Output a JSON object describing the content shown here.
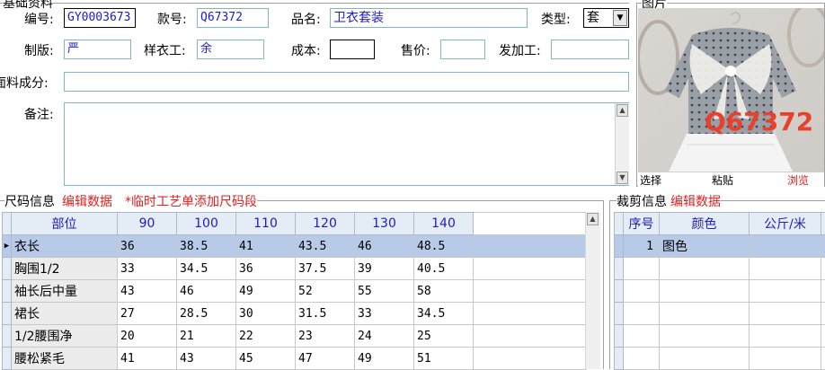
{
  "basic": {
    "title": "基础资料",
    "labels": {
      "code": "编号:",
      "style_no": "款号:",
      "product_name": "品名:",
      "type": "类型:",
      "pattern": "制版:",
      "sample_worker": "样衣工:",
      "cost": "成本:",
      "price": "售价:",
      "outsource": "发加工:",
      "fabric": "面料成分:",
      "remarks": "备注:"
    },
    "values": {
      "code": "GY0003673",
      "style_no": "Q67372",
      "product_name": "卫衣套装",
      "type": "套",
      "pattern": "严",
      "sample_worker": "余",
      "cost": "",
      "price": "",
      "outsource": "",
      "fabric": "",
      "remarks": ""
    }
  },
  "image_panel": {
    "title": "图片",
    "watermark": "Q67372",
    "actions": {
      "select": "选择",
      "paste": "粘贴",
      "browse": "浏览"
    }
  },
  "size_info": {
    "title": "尺码信息",
    "edit_link": "编辑数据",
    "note": "*临时工艺单添加尺码段",
    "headers": [
      "部位",
      "90",
      "100",
      "110",
      "120",
      "130",
      "140"
    ],
    "rows": [
      [
        "衣长",
        "36",
        "38.5",
        "41",
        "43.5",
        "46",
        "48.5"
      ],
      [
        "胸围1/2",
        "33",
        "34.5",
        "36",
        "37.5",
        "39",
        "40.5"
      ],
      [
        "袖长后中量",
        "43",
        "46",
        "49",
        "52",
        "55",
        "58"
      ],
      [
        "裙长",
        "27",
        "28.5",
        "30",
        "31.5",
        "33",
        "34.5"
      ],
      [
        "1/2腰围净",
        "20",
        "21",
        "22",
        "23",
        "24",
        "25"
      ],
      [
        "腰松紧毛",
        "41",
        "43",
        "45",
        "47",
        "49",
        "51"
      ]
    ]
  },
  "cutting_info": {
    "title": "裁剪信息",
    "edit_link": "编辑数据",
    "headers": [
      "序号",
      "颜色",
      "公斤/米"
    ],
    "rows": [
      [
        "1",
        "图色",
        ""
      ]
    ]
  },
  "colors": {
    "accent_red": "#e02020",
    "header_text": "#2020c0",
    "selected_row": "#b7cbe9",
    "field_text": "#1a1ad6"
  }
}
